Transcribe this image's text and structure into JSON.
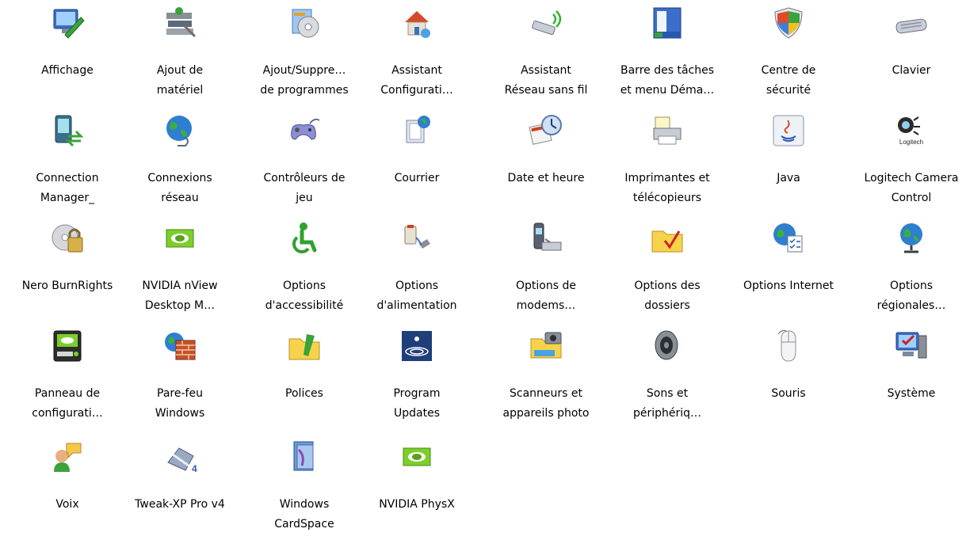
{
  "window": {
    "title": ""
  },
  "items": [
    {
      "id": "affichage",
      "icon": "display-icon",
      "lines": [
        "Affichage",
        ""
      ]
    },
    {
      "id": "ajout-materiel",
      "icon": "add-hardware-icon",
      "lines": [
        "Ajout de",
        "matériel"
      ]
    },
    {
      "id": "ajout-suppression",
      "icon": "add-remove-programs-icon",
      "lines": [
        "Ajout/Suppre…",
        "de programmes"
      ]
    },
    {
      "id": "assistant-config",
      "icon": "network-setup-icon",
      "lines": [
        "Assistant",
        "Configurati…"
      ]
    },
    {
      "id": "assistant-sans-fil",
      "icon": "wireless-network-icon",
      "lines": [
        "Assistant",
        "Réseau sans fil"
      ]
    },
    {
      "id": "barre-taches",
      "icon": "taskbar-icon",
      "lines": [
        "Barre des tâches",
        "et menu Déma…"
      ]
    },
    {
      "id": "centre-securite",
      "icon": "security-shield-icon",
      "lines": [
        "Centre de",
        "sécurité"
      ]
    },
    {
      "id": "clavier",
      "icon": "keyboard-icon",
      "lines": [
        "Clavier",
        ""
      ]
    },
    {
      "id": "connection-manager",
      "icon": "connection-manager-icon",
      "lines": [
        "Connection",
        "Manager_"
      ]
    },
    {
      "id": "connexions-reseau",
      "icon": "network-globe-icon",
      "lines": [
        "Connexions",
        "réseau"
      ]
    },
    {
      "id": "controleurs-jeu",
      "icon": "gamepad-icon",
      "lines": [
        "Contrôleurs de",
        "jeu"
      ]
    },
    {
      "id": "courrier",
      "icon": "mail-icon",
      "lines": [
        "Courrier",
        ""
      ]
    },
    {
      "id": "date-heure",
      "icon": "clock-calendar-icon",
      "lines": [
        "Date et heure",
        ""
      ]
    },
    {
      "id": "imprimantes",
      "icon": "printer-icon",
      "lines": [
        "Imprimantes et",
        "télécopieurs"
      ]
    },
    {
      "id": "java",
      "icon": "java-icon",
      "lines": [
        "Java",
        ""
      ]
    },
    {
      "id": "logitech",
      "icon": "logitech-camera-icon",
      "lines": [
        "Logitech Camera",
        "Control"
      ]
    },
    {
      "id": "nero",
      "icon": "nero-lock-icon",
      "lines": [
        "Nero BurnRights",
        ""
      ]
    },
    {
      "id": "nvidia-nview",
      "icon": "nvidia-icon",
      "lines": [
        "NVIDIA nView",
        "Desktop M…"
      ]
    },
    {
      "id": "accessibilite",
      "icon": "accessibility-icon",
      "lines": [
        "Options",
        "d'accessibilité"
      ]
    },
    {
      "id": "alimentation",
      "icon": "power-plug-icon",
      "lines": [
        "Options",
        "d'alimentation"
      ]
    },
    {
      "id": "modems",
      "icon": "phone-modem-icon",
      "lines": [
        "Options de",
        "modems…"
      ]
    },
    {
      "id": "dossiers",
      "icon": "folder-check-icon",
      "lines": [
        "Options des",
        "dossiers"
      ]
    },
    {
      "id": "internet",
      "icon": "internet-options-icon",
      "lines": [
        "Options Internet",
        ""
      ]
    },
    {
      "id": "regionales",
      "icon": "globe-stand-icon",
      "lines": [
        "Options",
        "régionales…"
      ]
    },
    {
      "id": "panneau-nvidia",
      "icon": "nvidia-panel-icon",
      "lines": [
        "Panneau de",
        "configurati…"
      ]
    },
    {
      "id": "pare-feu",
      "icon": "firewall-icon",
      "lines": [
        "Pare-feu",
        "Windows"
      ]
    },
    {
      "id": "polices",
      "icon": "fonts-folder-icon",
      "lines": [
        "Polices",
        ""
      ]
    },
    {
      "id": "program-updates",
      "icon": "updates-icon",
      "lines": [
        "Program",
        "Updates"
      ]
    },
    {
      "id": "scanneurs",
      "icon": "scanner-camera-icon",
      "lines": [
        "Scanneurs et",
        "appareils photo"
      ]
    },
    {
      "id": "sons",
      "icon": "speaker-icon",
      "lines": [
        "Sons et",
        "périphériq…"
      ]
    },
    {
      "id": "souris",
      "icon": "mouse-icon",
      "lines": [
        "Souris",
        ""
      ]
    },
    {
      "id": "systeme",
      "icon": "system-computer-icon",
      "lines": [
        "Système",
        ""
      ]
    },
    {
      "id": "voix",
      "icon": "speech-icon",
      "lines": [
        "Voix",
        ""
      ]
    },
    {
      "id": "tweak-xp",
      "icon": "tweak-xp-icon",
      "lines": [
        "Tweak-XP Pro v4",
        ""
      ]
    },
    {
      "id": "cardspace",
      "icon": "cardspace-icon",
      "lines": [
        "Windows",
        "CardSpace"
      ]
    },
    {
      "id": "physx",
      "icon": "nvidia-physx-icon",
      "lines": [
        "NVIDIA PhysX",
        ""
      ]
    }
  ]
}
